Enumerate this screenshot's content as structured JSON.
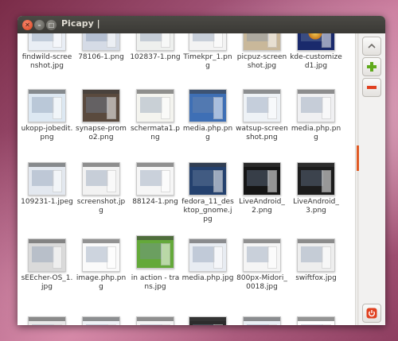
{
  "window": {
    "title": "Picapy |"
  },
  "toolbar": {
    "up_icon": "chevron-up-icon",
    "add_icon": "plus-icon",
    "remove_icon": "minus-icon",
    "quit_icon": "power-icon"
  },
  "scroll": {
    "position_fraction": 0.42
  },
  "colors": {
    "accent": "#e05a24",
    "add": "#5faa1c",
    "remove": "#e0401f",
    "titlebar": "#3c3b37"
  },
  "rows": [
    [
      {
        "label": "findwild-screenshot.jpg"
      },
      {
        "label": "78106-1.png"
      },
      {
        "label": "102837-1.png"
      },
      {
        "label": "Timekpr_1.png"
      },
      {
        "label": "picpuz-screenshot.jpg"
      },
      {
        "label": "kde-customized1.jpg"
      }
    ],
    [
      {
        "label": "ukopp-jobedit.png"
      },
      {
        "label": "synapse-promo2.png"
      },
      {
        "label": "schermata1.png"
      },
      {
        "label": "media.php.png"
      },
      {
        "label": "watsup-screenshot.png"
      },
      {
        "label": "media.php.png"
      }
    ],
    [
      {
        "label": "109231-1.jpeg"
      },
      {
        "label": "screenshot.jpg"
      },
      {
        "label": "88124-1.png"
      },
      {
        "label": "fedora_11_desktop_gnome.jpg"
      },
      {
        "label": "LiveAndroid_2.png"
      },
      {
        "label": "LiveAndroid_3.png"
      }
    ],
    [
      {
        "label": "sEEcher-OS_1.jpg"
      },
      {
        "label": "image.php.png"
      },
      {
        "label": "in action - trans.jpg"
      },
      {
        "label": "media.php.jpg"
      },
      {
        "label": "800px-Midori_0018.jpg"
      },
      {
        "label": "swiftfox.jpg"
      }
    ],
    [
      {
        "label": ""
      },
      {
        "label": ""
      },
      {
        "label": ""
      },
      {
        "label": ""
      },
      {
        "label": ""
      },
      {
        "label": ""
      }
    ]
  ]
}
